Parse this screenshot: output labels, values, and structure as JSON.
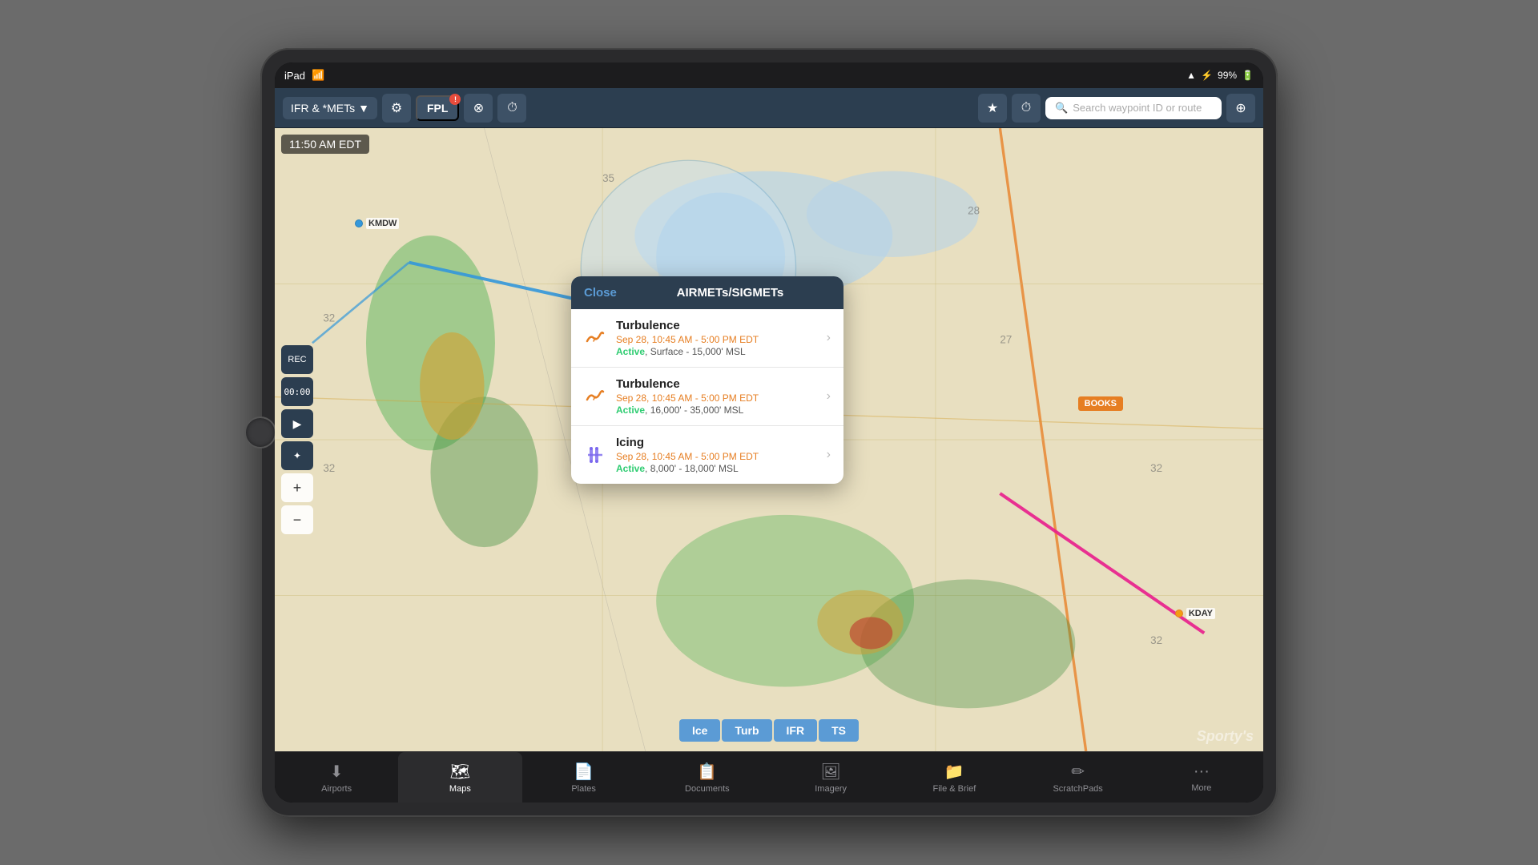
{
  "device": {
    "status_bar": {
      "carrier": "iPad",
      "wifi_icon": "wifi",
      "time": "",
      "location_icon": "▲",
      "bluetooth_icon": "B",
      "battery_percent": "99%",
      "battery_icon": "battery"
    }
  },
  "toolbar": {
    "dropdown_label": "IFR & *METs",
    "settings_icon": "gear",
    "fpl_label": "FPL",
    "fpl_badge": "!",
    "sync_icon": "sync",
    "timer_icon": "timer",
    "bookmark_icon": "★",
    "clock_icon": "⏱",
    "search_placeholder": "Search waypoint ID or route",
    "location_icon": "⊕"
  },
  "map": {
    "time_display": "11:50 AM EDT",
    "waypoints": {
      "kmdw": "KMDW",
      "kday": "KDAY",
      "books": "BOOKS"
    },
    "controls": {
      "rec": "REC",
      "timer": "00:00",
      "play": "▶",
      "route": "⌘",
      "zoom_in": "+",
      "zoom_out": "−"
    },
    "weather_buttons": [
      {
        "label": "Ice",
        "active": true
      },
      {
        "label": "Turb",
        "active": true
      },
      {
        "label": "IFR",
        "active": true
      },
      {
        "label": "TS",
        "active": true
      }
    ]
  },
  "airmet_popup": {
    "close_label": "Close",
    "title": "AIRMETs/SIGMETs",
    "items": [
      {
        "type": "Turbulence",
        "time": "Sep 28, 10:45 AM - 5:00 PM EDT",
        "status": "Active",
        "detail": "Surface - 15,000' MSL",
        "icon_type": "turb"
      },
      {
        "type": "Turbulence",
        "time": "Sep 28, 10:45 AM - 5:00 PM EDT",
        "status": "Active",
        "detail": "16,000' - 35,000' MSL",
        "icon_type": "turb"
      },
      {
        "type": "Icing",
        "time": "Sep 28, 10:45 AM - 5:00 PM EDT",
        "status": "Active",
        "detail": "8,000' - 18,000' MSL",
        "icon_type": "ice"
      }
    ]
  },
  "tab_bar": {
    "items": [
      {
        "label": "Airports",
        "icon": "🛬",
        "active": false
      },
      {
        "label": "Maps",
        "icon": "🗺",
        "active": true
      },
      {
        "label": "Plates",
        "icon": "📄",
        "active": false
      },
      {
        "label": "Documents",
        "icon": "📋",
        "active": false
      },
      {
        "label": "Imagery",
        "icon": "🖼",
        "active": false
      },
      {
        "label": "File & Brief",
        "icon": "📁",
        "active": false
      },
      {
        "label": "ScratchPads",
        "icon": "✏️",
        "active": false
      },
      {
        "label": "More",
        "icon": "•••",
        "active": false
      }
    ]
  },
  "watermark": "Sporty's"
}
